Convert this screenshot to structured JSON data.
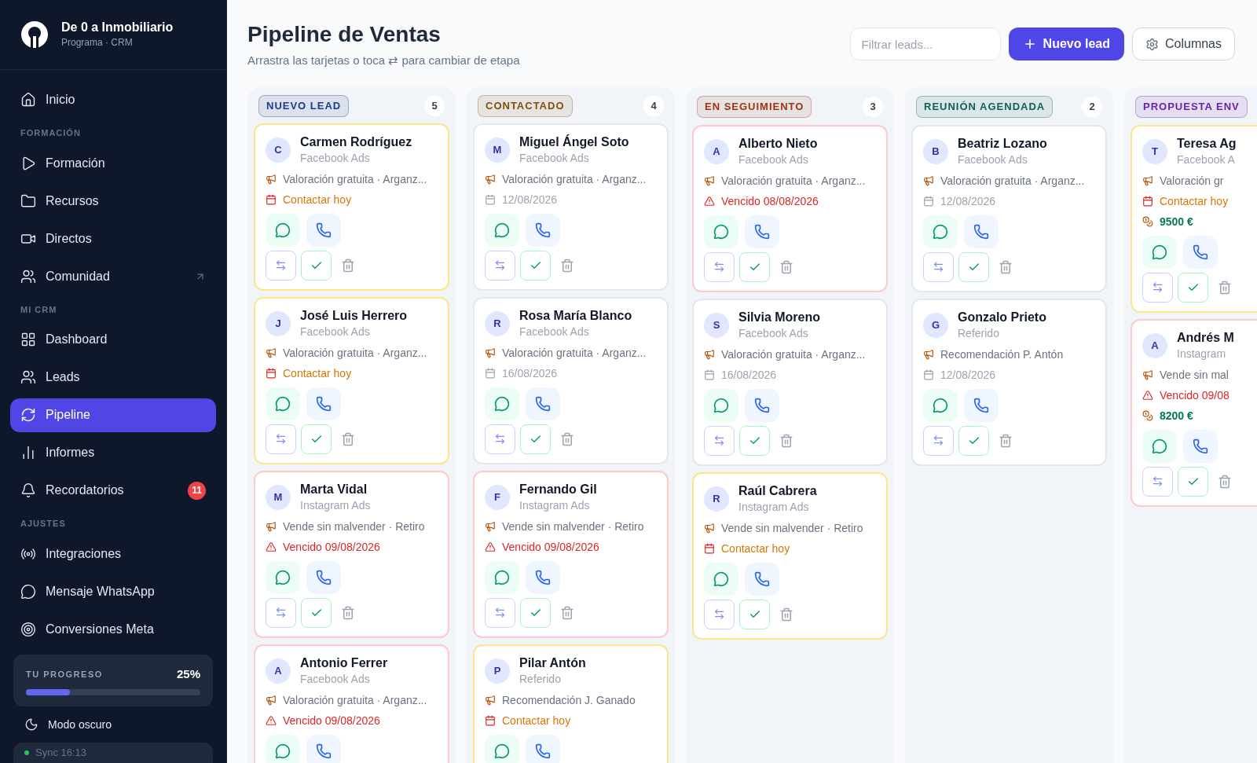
{
  "brand": {
    "name": "De 0 a Inmobiliario",
    "subtitle": "Programa · CRM"
  },
  "sidebar": {
    "sections": [
      {
        "items": [
          {
            "label": "Inicio",
            "selected": false
          }
        ]
      },
      {
        "heading": "FORMACIÓN",
        "items": [
          {
            "label": "Formación",
            "selected": false
          },
          {
            "label": "Recursos",
            "selected": false
          },
          {
            "label": "Directos",
            "selected": false
          },
          {
            "label": "Comunidad",
            "selected": false,
            "external": true
          }
        ]
      },
      {
        "heading": "MI CRM",
        "items": [
          {
            "label": "Dashboard",
            "selected": false
          },
          {
            "label": "Leads",
            "selected": false
          },
          {
            "label": "Pipeline",
            "selected": true
          },
          {
            "label": "Informes",
            "selected": false
          },
          {
            "label": "Recordatorios",
            "selected": false,
            "badge": "11"
          }
        ]
      },
      {
        "heading": "AJUSTES",
        "items": [
          {
            "label": "Integraciones",
            "selected": false
          },
          {
            "label": "Mensaje WhatsApp",
            "selected": false
          },
          {
            "label": "Conversiones Meta",
            "selected": false
          }
        ]
      }
    ],
    "progress": {
      "label": "TU PROGRESO",
      "value": "25%",
      "level": 0.25
    },
    "dark_mode": {
      "label": "Modo oscuro"
    },
    "sync": {
      "label": "Sync 16:13"
    }
  },
  "header": {
    "title": "Pipeline de Ventas",
    "subtitle": "Arrastra las tarjetas o toca ⇄ para cambiar de etapa",
    "filter": {
      "placeholder": "Filtrar leads..."
    },
    "new_button": "Nuevo lead",
    "columns_button": "Columnas"
  },
  "columns": [
    {
      "title": "NUEVO LEAD",
      "count": "5",
      "color": "#1e3a8a",
      "cards": [
        {
          "initial": "C",
          "name": "Carmen Rodríguez",
          "source": "Facebook Ads",
          "campaign": "Valoración gratuita · Arganz...",
          "due": {
            "kind": "today",
            "text": "Contactar hoy"
          }
        },
        {
          "initial": "J",
          "name": "José Luis Herrero",
          "source": "Facebook Ads",
          "campaign": "Valoración gratuita · Arganz...",
          "due": {
            "kind": "today",
            "text": "Contactar hoy"
          }
        },
        {
          "initial": "M",
          "name": "Marta Vidal",
          "source": "Instagram Ads",
          "campaign": "Vende sin malvender · Retiro",
          "due": {
            "kind": "overdue",
            "text": "Vencido 09/08/2026"
          }
        },
        {
          "initial": "A",
          "name": "Antonio Ferrer",
          "source": "Facebook Ads",
          "campaign": "Valoración gratuita · Arganz...",
          "due": {
            "kind": "overdue",
            "text": "Vencido 09/08/2026"
          }
        }
      ]
    },
    {
      "title": "CONTACTADO",
      "count": "4",
      "color": "#854d0e",
      "cards": [
        {
          "initial": "M",
          "name": "Miguel Ángel Soto",
          "source": "Facebook Ads",
          "campaign": "Valoración gratuita · Arganz...",
          "due": {
            "kind": "scheduled",
            "text": "12/08/2026"
          }
        },
        {
          "initial": "R",
          "name": "Rosa María Blanco",
          "source": "Facebook Ads",
          "campaign": "Valoración gratuita · Arganz...",
          "due": {
            "kind": "scheduled",
            "text": "16/08/2026"
          }
        },
        {
          "initial": "F",
          "name": "Fernando Gil",
          "source": "Instagram Ads",
          "campaign": "Vende sin malvender · Retiro",
          "due": {
            "kind": "overdue",
            "text": "Vencido 09/08/2026"
          }
        },
        {
          "initial": "P",
          "name": "Pilar Antón",
          "source": "Referido",
          "campaign": "Recomendación J. Ganado",
          "due": {
            "kind": "today",
            "text": "Contactar hoy"
          }
        }
      ]
    },
    {
      "title": "EN SEGUIMIENTO",
      "count": "3",
      "color": "#9a3412",
      "cards": [
        {
          "initial": "A",
          "name": "Alberto Nieto",
          "source": "Facebook Ads",
          "campaign": "Valoración gratuita · Arganz...",
          "due": {
            "kind": "overdue",
            "text": "Vencido 08/08/2026"
          }
        },
        {
          "initial": "S",
          "name": "Silvia Moreno",
          "source": "Facebook Ads",
          "campaign": "Valoración gratuita · Arganz...",
          "due": {
            "kind": "scheduled",
            "text": "16/08/2026"
          }
        },
        {
          "initial": "R",
          "name": "Raúl Cabrera",
          "source": "Instagram Ads",
          "campaign": "Vende sin malvender · Retiro",
          "due": {
            "kind": "today",
            "text": "Contactar hoy"
          }
        }
      ]
    },
    {
      "title": "REUNIÓN AGENDADA",
      "count": "2",
      "color": "#115e59",
      "cards": [
        {
          "initial": "B",
          "name": "Beatriz Lozano",
          "source": "Facebook Ads",
          "campaign": "Valoración gratuita · Arganz...",
          "due": {
            "kind": "scheduled",
            "text": "12/08/2026"
          }
        },
        {
          "initial": "G",
          "name": "Gonzalo Prieto",
          "source": "Referido",
          "campaign": "Recomendación P. Antón",
          "due": {
            "kind": "scheduled",
            "text": "12/08/2026"
          }
        }
      ]
    },
    {
      "title": "PROPUESTA ENV",
      "color": "#6b21a8",
      "cards": [
        {
          "initial": "T",
          "name": "Teresa Ag",
          "source": "Facebook A",
          "campaign": "Valoración gr",
          "due": {
            "kind": "today",
            "text": "Contactar hoy"
          },
          "amount": "9500 €"
        },
        {
          "initial": "A",
          "name": "Andrés M",
          "source": "Instagram",
          "campaign": "Vende sin mal",
          "due": {
            "kind": "overdue",
            "text": "Vencido 09/08"
          },
          "amount": "8200 €"
        }
      ]
    }
  ]
}
